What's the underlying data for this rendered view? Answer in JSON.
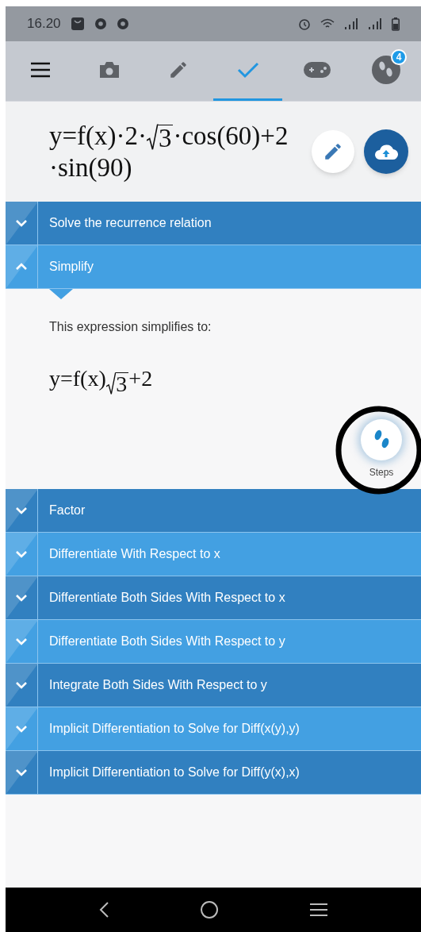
{
  "status_bar": {
    "time": "16.20"
  },
  "toolbar": {
    "tabs": [
      {
        "selected": false
      },
      {
        "selected": false
      },
      {
        "selected": false
      },
      {
        "selected": true
      },
      {
        "selected": false
      },
      {
        "selected": false,
        "badge": "4"
      }
    ]
  },
  "expression": {
    "lines": [
      [
        {
          "kind": "text",
          "text": "y=f(x)·2·"
        },
        {
          "kind": "sqrt",
          "text": "3"
        },
        {
          "kind": "text",
          "text": "·cos(60)+2"
        }
      ],
      [
        {
          "kind": "text",
          "text": "·sin(90)"
        }
      ]
    ]
  },
  "sections": [
    {
      "label": "Solve the recurrence relation",
      "expanded": false
    },
    {
      "label": "Simplify",
      "expanded": true,
      "body": {
        "text": "This expression simplifies to:",
        "result": [
          {
            "kind": "text",
            "text": "y=f(x)"
          },
          {
            "kind": "sqrt",
            "text": "3"
          },
          {
            "kind": "text",
            "text": "+2"
          }
        ],
        "steps_button": "Steps"
      }
    },
    {
      "label": "Factor",
      "expanded": false
    },
    {
      "label": "Differentiate With Respect to x",
      "expanded": false
    },
    {
      "label": "Differentiate Both Sides With Respect to x",
      "expanded": false
    },
    {
      "label": "Differentiate Both Sides With Respect to y",
      "expanded": false
    },
    {
      "label": "Integrate Both Sides With Respect to y",
      "expanded": false
    },
    {
      "label": "Implicit Differentiation to Solve for Diff(x(y),y)",
      "expanded": false
    },
    {
      "label": "Implicit Differentiation to Solve for Diff(y(x),x)",
      "expanded": false
    }
  ]
}
